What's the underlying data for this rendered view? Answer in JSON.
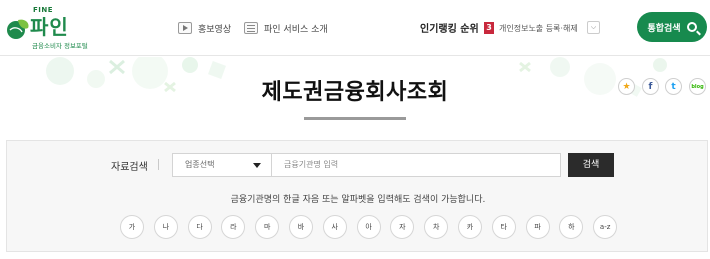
{
  "logo": {
    "brand_small": "FINE",
    "title": "파인",
    "subtitle": "금융소비자 정보포털"
  },
  "nav": {
    "video": {
      "label": "홍보영상",
      "icon": "video-icon"
    },
    "about": {
      "label": "파인 서비스 소개",
      "icon": "document-icon"
    }
  },
  "ranking": {
    "label": "인기랭킹 순위",
    "rank_number": "3",
    "rank_item": "개인정보노출 등록·해제",
    "caret": "chevron-down-icon"
  },
  "header_search_button": {
    "label": "통합검색",
    "icon": "search-icon"
  },
  "banner": {
    "title": "제도권금융회사조회",
    "share": {
      "star": "★",
      "facebook": "f",
      "twitter": "t",
      "blog": "blog"
    }
  },
  "search": {
    "label": "자료검색",
    "select_value": "업종선택",
    "input_placeholder": "금융기관명 입력",
    "button_label": "검색",
    "hint": "금융기관명의 한글 자음 또는 알파벳을 입력해도 검색이 가능합니다.",
    "letters": [
      "가",
      "나",
      "다",
      "라",
      "마",
      "바",
      "사",
      "아",
      "자",
      "차",
      "카",
      "타",
      "파",
      "하",
      "a-z"
    ]
  },
  "colors": {
    "brand_green": "#178a4e",
    "rank_red": "#c8283c",
    "dark_button": "#2b2b2b"
  }
}
